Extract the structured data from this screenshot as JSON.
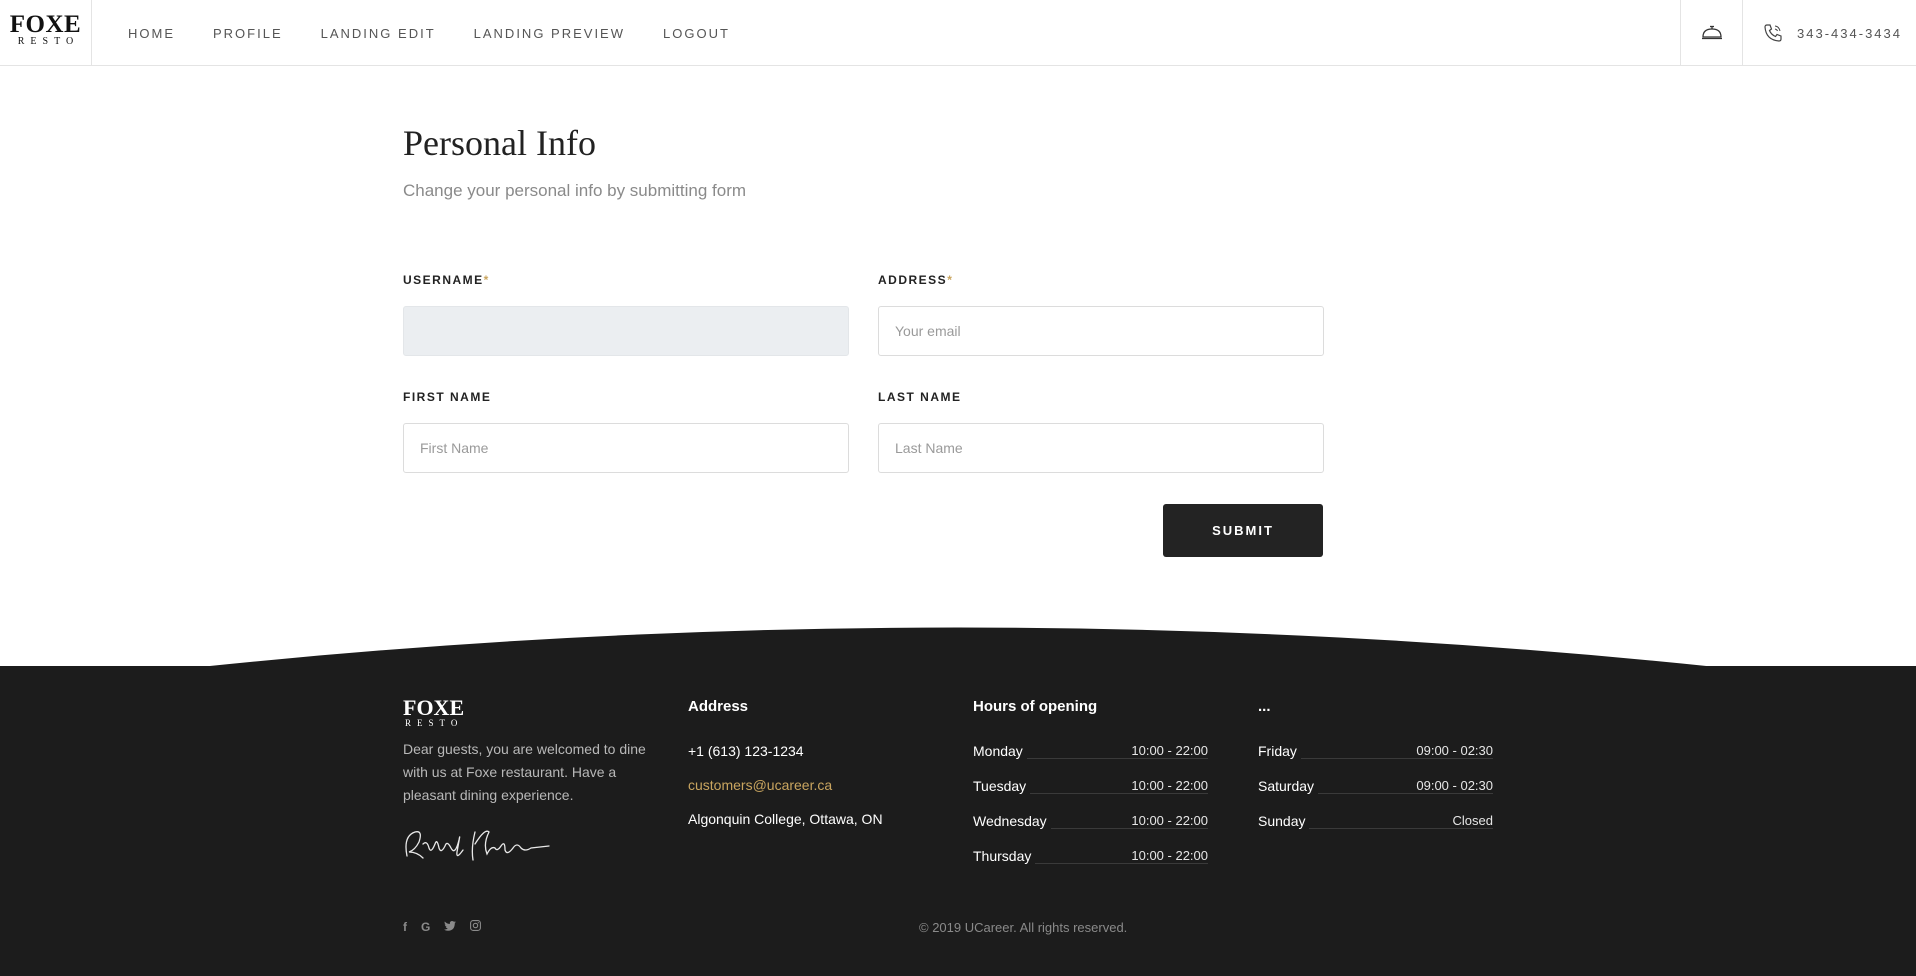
{
  "brand": {
    "name": "FOXE",
    "sub": "RESTO"
  },
  "nav": {
    "items": [
      {
        "label": "HOME"
      },
      {
        "label": "PROFILE"
      },
      {
        "label": "LANDING EDIT"
      },
      {
        "label": "LANDING PREVIEW"
      },
      {
        "label": "LOGOUT"
      }
    ]
  },
  "header": {
    "phone": "343-434-3434",
    "bell_icon": "service-bell-icon",
    "phone_icon": "phone-icon"
  },
  "page": {
    "title": "Personal Info",
    "subtitle": "Change your personal info by submitting form"
  },
  "form": {
    "username": {
      "label": "USERNAME",
      "required": "*",
      "value": "",
      "placeholder": ""
    },
    "address": {
      "label": "ADDRESS",
      "required": "*",
      "value": "",
      "placeholder": "Your email"
    },
    "first_name": {
      "label": "FIRST NAME",
      "value": "",
      "placeholder": "First Name"
    },
    "last_name": {
      "label": "LAST NAME",
      "value": "",
      "placeholder": "Last Name"
    },
    "submit_label": "SUBMIT"
  },
  "footer": {
    "description": "Dear guests, you are welcomed to dine with us at Foxe restaurant. Have a pleasant dining experience.",
    "address": {
      "title": "Address",
      "phone": "+1 (613) 123-1234",
      "email": "customers@ucareer.ca",
      "location": "Algonquin College, Ottawa, ON"
    },
    "hours": {
      "title": "Hours of opening",
      "title2": "...",
      "col1": [
        {
          "day": "Monday",
          "time": "10:00 - 22:00"
        },
        {
          "day": "Tuesday",
          "time": "10:00 - 22:00"
        },
        {
          "day": "Wednesday",
          "time": "10:00 - 22:00"
        },
        {
          "day": "Thursday",
          "time": "10:00 - 22:00"
        }
      ],
      "col2": [
        {
          "day": "Friday",
          "time": "09:00 - 02:30"
        },
        {
          "day": "Saturday",
          "time": "09:00 - 02:30"
        },
        {
          "day": "Sunday",
          "time": "Closed"
        }
      ]
    },
    "socials": [
      {
        "icon": "facebook-icon",
        "glyph": "f"
      },
      {
        "icon": "google-icon",
        "glyph": "G"
      },
      {
        "icon": "twitter-icon",
        "glyph": "t"
      },
      {
        "icon": "instagram-icon",
        "glyph": "◎"
      }
    ],
    "copyright": "© 2019 UCareer. All rights reserved."
  },
  "colors": {
    "accent": "#c9a55f",
    "footer_bg": "#1c1c1c",
    "button_bg": "#232323",
    "disabled_input": "#ebeef1"
  }
}
